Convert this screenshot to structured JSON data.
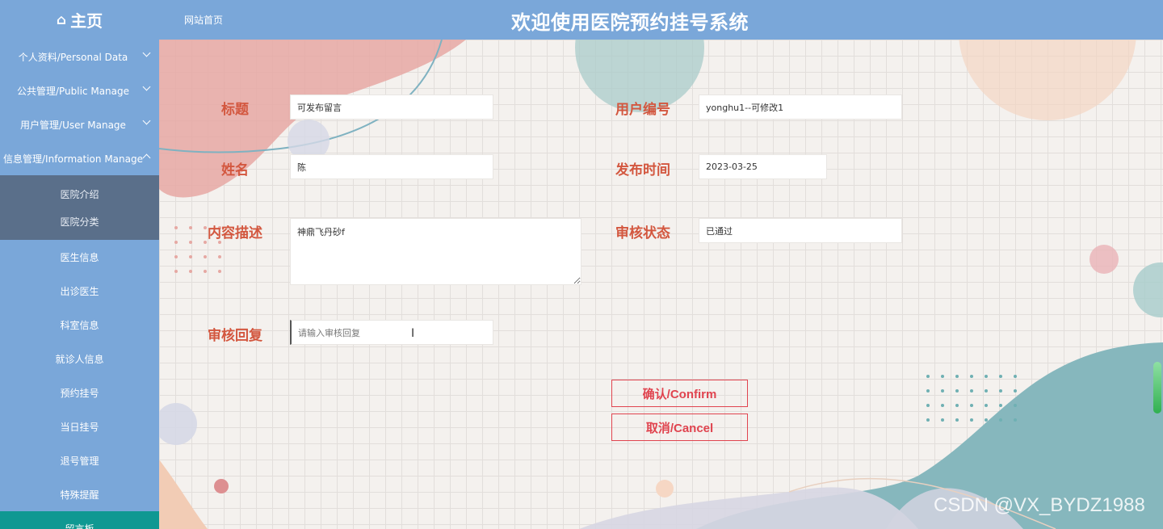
{
  "header": {
    "home_label": "主页",
    "breadcrumb": "网站首页",
    "title": "欢迎使用医院预约挂号系统"
  },
  "sidebar": {
    "items": [
      {
        "label": "个人资料/Personal Data"
      },
      {
        "label": "公共管理/Public Manage"
      },
      {
        "label": "用户管理/User Manage"
      },
      {
        "label": "信息管理/Information Manage"
      }
    ],
    "submenu": [
      "医院介绍",
      "医院分类"
    ],
    "plain_items": [
      "医生信息",
      "出诊医生",
      "科室信息",
      "就诊人信息",
      "预约挂号",
      "当日挂号",
      "退号管理",
      "特殊提醒",
      "留言板"
    ]
  },
  "form": {
    "title_label": "标题",
    "title_value": "可发布留言",
    "user_id_label": "用户编号",
    "user_id_value": "yonghu1--可修改1",
    "name_label": "姓名",
    "name_value": "陈",
    "publish_time_label": "发布时间",
    "publish_time_value": "2023-03-25",
    "content_label": "内容描述",
    "content_value": "神鼎飞丹砂f",
    "status_label": "审核状态",
    "status_value": "已通过",
    "reply_label": "审核回复",
    "reply_placeholder": "请输入审核回复"
  },
  "buttons": {
    "confirm": "确认/Confirm",
    "cancel": "取消/Cancel"
  },
  "watermark": "CSDN @VX_BYDZ1988",
  "colors": {
    "header_bg": "#7aa7d9",
    "submenu_bg": "#5a6f8a",
    "active_bg": "#0f9892",
    "label_color": "#d3573f",
    "button_color": "#e0444f"
  },
  "icons": {
    "home": "home-icon",
    "expand": "chevron-down-icon",
    "collapse": "chevron-up-icon",
    "text_cursor": "text-cursor-icon"
  }
}
